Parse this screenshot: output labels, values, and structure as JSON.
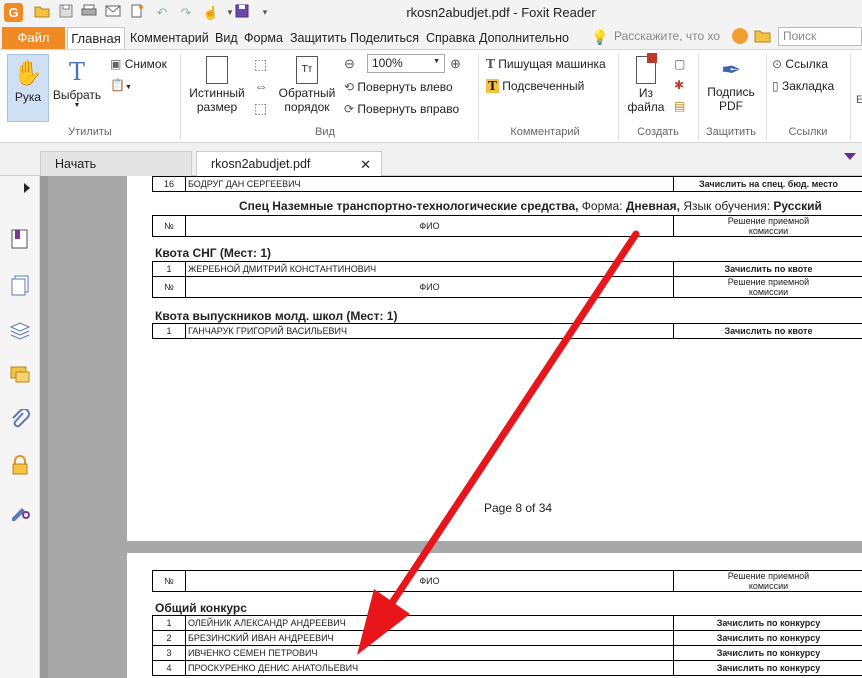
{
  "window": {
    "title": "rkosn2abudjet.pdf - Foxit Reader",
    "app_logo": "G"
  },
  "ribbon_tabs": [
    "Файл",
    "Главная",
    "Комментарий",
    "Вид",
    "Форма",
    "Защитить",
    "Поделиться",
    "Справка",
    "Дополнительно"
  ],
  "tell_me": "Расскажите, что хо",
  "search_placeholder": "Поиск",
  "ribbon": {
    "hand": "Рука",
    "select": "Выбрать",
    "snapshot": "Снимок",
    "group_utilities": "Утилиты",
    "actual_size": [
      "Истинный",
      "размер"
    ],
    "reverse_order": [
      "Обратный",
      "порядок"
    ],
    "zoom_value": "100%",
    "rotate_left": "Повернуть влево",
    "rotate_right": "Повернуть вправо",
    "group_view": "Вид",
    "typewriter": "Пишущая машинка",
    "highlight": "Подсвеченный",
    "group_comment": "Комментарий",
    "from_file": [
      "Из",
      "файла"
    ],
    "group_create": "Создать",
    "sign_pdf": [
      "Подпись",
      "PDF"
    ],
    "group_protect": "Защитить",
    "link": "Ссылка",
    "bookmark": "Закладка",
    "group_links": "Ссылки"
  },
  "doc_tabs": [
    "Начать",
    "rkosn2abudjet.pdf"
  ],
  "page1": {
    "top_row": {
      "num": "16",
      "fio": "БОДРУГ ДАН СЕРГЕЕВИЧ",
      "decision": "Зачислить на спец. бюд. место"
    },
    "spec_prefix": "Спец Наземные транспортно-технологические средства,",
    "spec_form_label": " Форма: ",
    "spec_form": "Дневная,",
    "spec_lang_label": " Язык обучения: ",
    "spec_lang": "Русский",
    "col_num": "№",
    "col_fio": "ФИО",
    "col_decision": [
      "Решение приемной",
      "комиссии"
    ],
    "section1": "Квота СНГ (Мест: 1)",
    "row1": {
      "num": "1",
      "fio": "ЖЕРЕБНОЙ ДМИТРИЙ КОНСТАНТИНОВИЧ",
      "decision": "Зачислить по квоте"
    },
    "section2": "Квота выпускников молд. школ (Мест: 1)",
    "row2": {
      "num": "1",
      "fio": "ГАНЧАРУК ГРИГОРИЙ ВАСИЛЬЕВИЧ",
      "decision": "Зачислить по квоте"
    },
    "page_label": "Page 8 of 34"
  },
  "page2": {
    "col_num": "№",
    "col_fio": "ФИО",
    "col_decision": [
      "Решение приемной",
      "комиссии"
    ],
    "section": "Общий конкурс",
    "rows": [
      {
        "num": "1",
        "fio": "ОЛЕЙНИК АЛЕКСАНДР АНДРЕЕВИЧ",
        "decision": "Зачислить по конкурсу"
      },
      {
        "num": "2",
        "fio": "БРЕЗИНСКИЙ ИВАН АНДРЕЕВИЧ",
        "decision": "Зачислить по конкурсу"
      },
      {
        "num": "3",
        "fio": "ИВЧЕНКО СЕМЕН ПЕТРОВИЧ",
        "decision": "Зачислить по конкурсу"
      },
      {
        "num": "4",
        "fio": "ПРОСКУРЕНКО ДЕНИС АНАТОЛЬЕВИЧ",
        "decision": "Зачислить по конкурсу"
      }
    ]
  },
  "colors": {
    "accent": "#f08a24",
    "arrow": "#e8161b"
  }
}
